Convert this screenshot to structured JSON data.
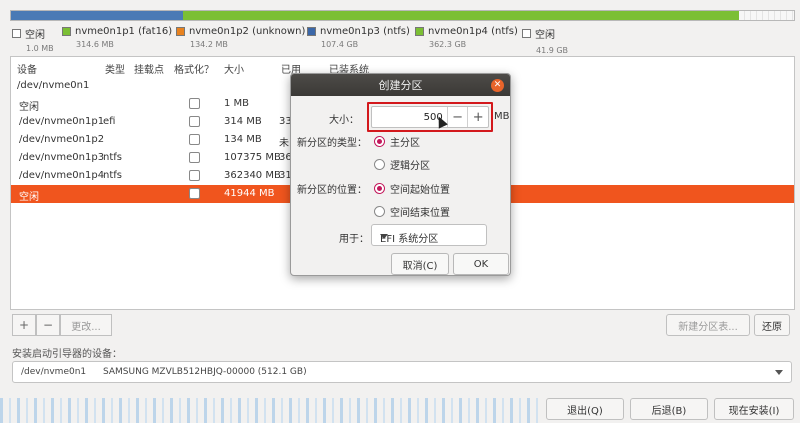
{
  "disk_bar": {
    "segments": [
      {
        "name": "nvme0n1p1",
        "color": "#4a7ab5",
        "fraction": 0.22
      },
      {
        "name": "nvme0n1p3",
        "color": "#7bbf34",
        "fraction": 0.71
      },
      {
        "name": "free",
        "color": "#f4f4f4",
        "fraction": 0.07
      }
    ]
  },
  "legend": [
    {
      "label": "空闲",
      "size": "1.0 MB",
      "color": "#ffffff"
    },
    {
      "label": "nvme0n1p1 (fat16)",
      "size": "314.6 MB",
      "color": "#7bbf34"
    },
    {
      "label": "nvme0n1p2 (unknown)",
      "size": "134.2 MB",
      "color": "#e8821f"
    },
    {
      "label": "nvme0n1p3 (ntfs)",
      "size": "107.4 GB",
      "color": "#3b67a8"
    },
    {
      "label": "nvme0n1p4 (ntfs)",
      "size": "362.3 GB",
      "color": "#7bbf34"
    },
    {
      "label": "空闲",
      "size": "41.9 GB",
      "color": "#ffffff"
    }
  ],
  "table": {
    "headers": [
      "设备",
      "类型",
      "挂载点",
      "格式化？",
      "大小",
      "已用",
      "已装系统"
    ],
    "disk_label": "/dev/nvme0n1",
    "rows": [
      {
        "device": "空闲",
        "type": "",
        "size": "1 MB",
        "used": "",
        "selected": false
      },
      {
        "device": "/dev/nvme0n1p1",
        "type": "efi",
        "size": "314 MB",
        "used": "33",
        "selected": false
      },
      {
        "device": "/dev/nvme0n1p2",
        "type": "",
        "size": "134 MB",
        "used": "未",
        "selected": false
      },
      {
        "device": "/dev/nvme0n1p3",
        "type": "ntfs",
        "size": "107375 MB",
        "used": "36",
        "selected": false
      },
      {
        "device": "/dev/nvme0n1p4",
        "type": "ntfs",
        "size": "362340 MB",
        "used": "31",
        "selected": false
      },
      {
        "device": "空闲",
        "type": "",
        "size": "41944 MB",
        "used": "",
        "selected": true
      }
    ]
  },
  "table_buttons": {
    "add": "+",
    "remove": "−",
    "change": "更改..."
  },
  "new_table_button": "新建分区表...",
  "revert_button": "还原",
  "boot_loader": {
    "label": "安装启动引导器的设备：",
    "device": "/dev/nvme0n1",
    "description": "SAMSUNG MZVLB512HBJQ-00000 (512.1 GB)"
  },
  "footer": {
    "quit": "退出(Q)",
    "back": "后退(B)",
    "install": "现在安装(I)"
  },
  "dialog": {
    "title": "创建分区",
    "close": "✕",
    "size_label": "大小：",
    "size_value": "500",
    "unit": "MB",
    "minus": "−",
    "plus": "+",
    "type_label": "新分区的类型：",
    "type_primary": "主分区",
    "type_logical": "逻辑分区",
    "location_label": "新分区的位置：",
    "location_start": "空间起始位置",
    "location_end": "空间结束位置",
    "use_label": "用于：",
    "use_value": "EFI 系统分区",
    "cancel": "取消(C)",
    "ok": "OK"
  }
}
